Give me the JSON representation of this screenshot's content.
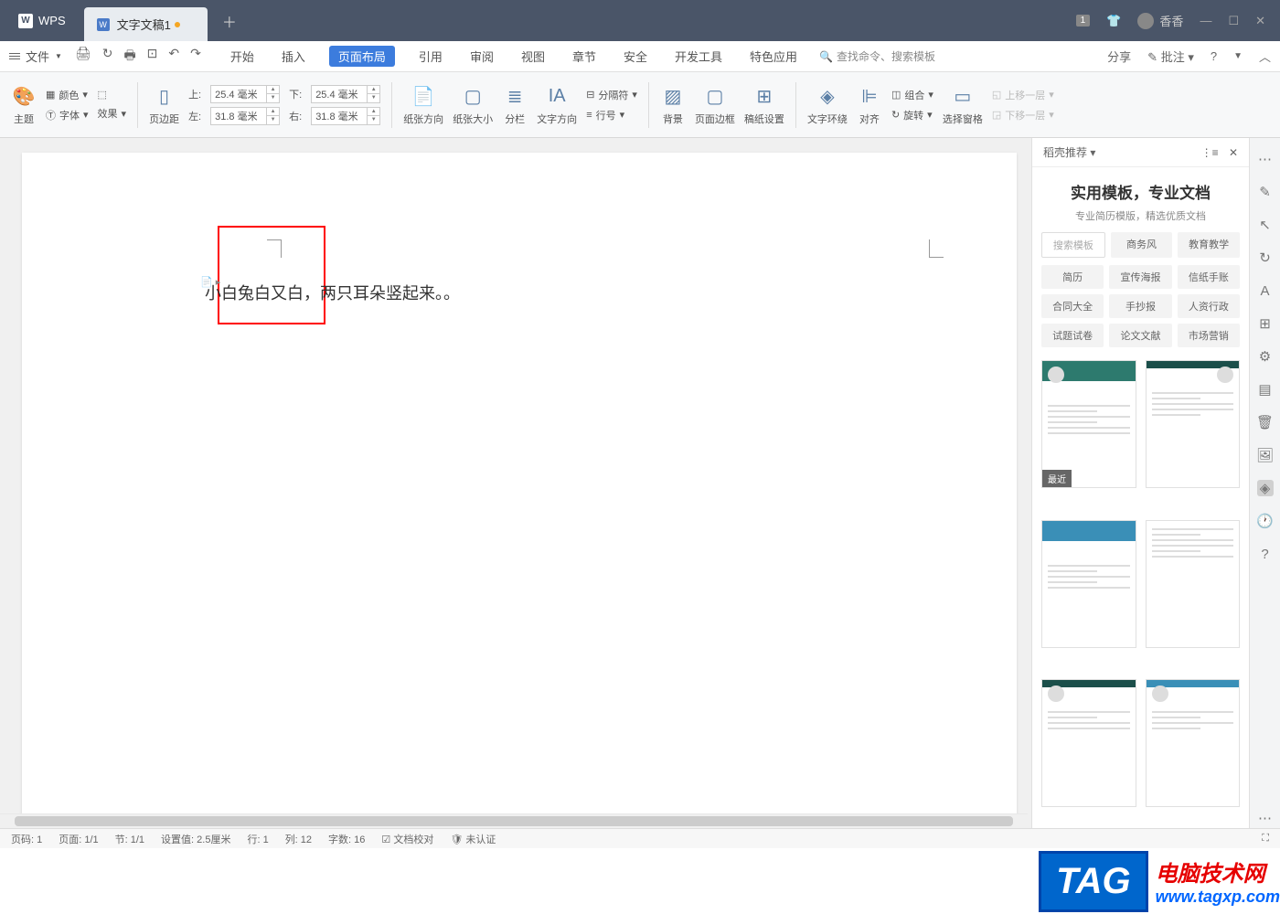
{
  "titlebar": {
    "wps_label": "WPS",
    "doc_tab": "文字文稿1",
    "user_name": "香香"
  },
  "menubar": {
    "file": "文件",
    "tabs": [
      "开始",
      "插入",
      "页面布局",
      "引用",
      "审阅",
      "视图",
      "章节",
      "安全",
      "开发工具",
      "特色应用"
    ],
    "active_index": 2,
    "search": "查找命令、搜索模板",
    "share": "分享",
    "annotate": "批注"
  },
  "ribbon": {
    "theme": "主题",
    "color": "颜色",
    "font": "字体",
    "effect": "效果",
    "page_margin": "页边距",
    "margins": {
      "top_label": "上:",
      "top": "25.4 毫米",
      "bottom_label": "下:",
      "bottom": "25.4 毫米",
      "left_label": "左:",
      "left": "31.8 毫米",
      "right_label": "右:",
      "right": "31.8 毫米"
    },
    "orientation": "纸张方向",
    "size": "纸张大小",
    "columns": "分栏",
    "text_dir": "文字方向",
    "breaks": "分隔符",
    "line_num": "行号",
    "background": "背景",
    "page_border": "页面边框",
    "draft_setup": "稿纸设置",
    "wrap": "文字环绕",
    "align": "对齐",
    "group": "组合",
    "rotate": "旋转",
    "select_pane": "选择窗格",
    "bring_fwd": "上移一层",
    "send_back": "下移一层"
  },
  "document": {
    "text": "小白兔白又白，两只耳朵竖起来。。"
  },
  "side": {
    "header": "稻壳推荐",
    "title": "实用模板，专业文档",
    "subtitle": "专业简历模版，精选优质文档",
    "tabs": [
      "搜索模板",
      "商务风",
      "教育教学"
    ],
    "cats": [
      "简历",
      "宣传海报",
      "信纸手账",
      "合同大全",
      "手抄报",
      "人资行政",
      "试题试卷",
      "论文文献",
      "市场营销"
    ],
    "recent_badge": "最近"
  },
  "statusbar": {
    "page_code": "页码: 1",
    "page": "页面: 1/1",
    "section": "节: 1/1",
    "setting": "设置值: 2.5厘米",
    "row": "行: 1",
    "col": "列: 12",
    "chars": "字数: 16",
    "proof": "文档校对",
    "auth": "未认证"
  },
  "watermark": {
    "tag": "TAG",
    "line1": "电脑技术网",
    "line2": "www.tagxp.com"
  }
}
